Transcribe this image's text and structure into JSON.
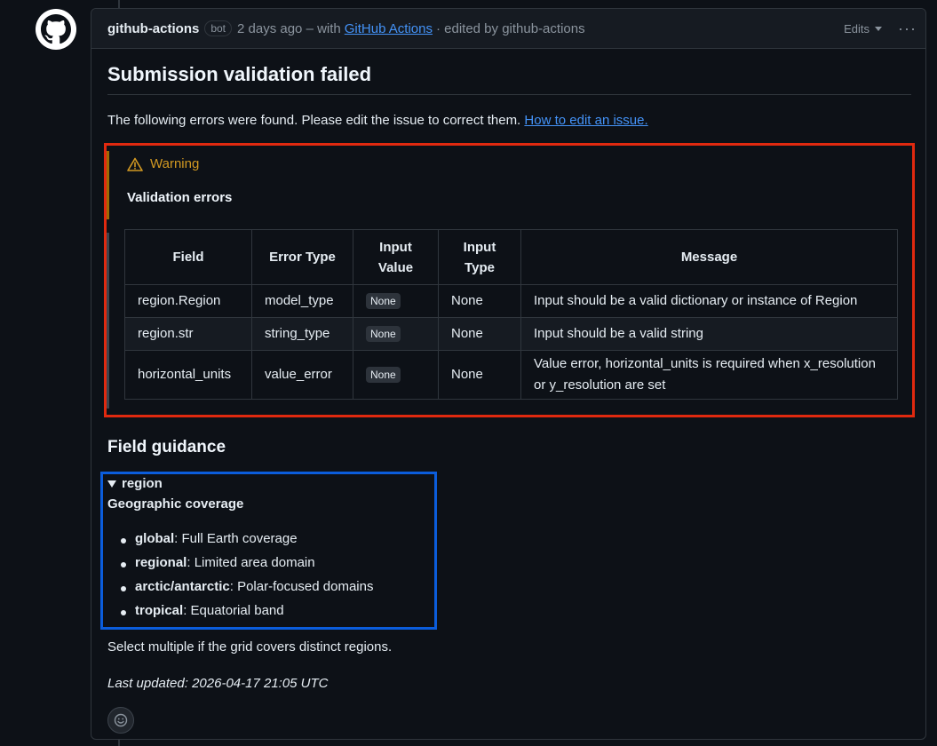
{
  "comment": {
    "author": "github-actions",
    "badge": "bot",
    "time": "2 days ago – with",
    "app_link": "GitHub Actions",
    "edited_by": "· edited by github-actions",
    "edits_label": "Edits",
    "more_label": "···"
  },
  "content": {
    "title": "Submission validation failed",
    "intro": "The following errors were found. Please edit the issue to correct them.",
    "intro_link": "How to edit an issue.",
    "alert_label": "Warning",
    "alert_sub": "Validation errors",
    "table": {
      "headers": [
        "Field",
        "Error Type",
        "Input Value",
        "Input Type",
        "Message"
      ],
      "rows": [
        {
          "field": "region.Region",
          "error_type": "model_type",
          "input_value": "None",
          "input_type": "None",
          "message": "Input should be a valid dictionary or instance of Region"
        },
        {
          "field": "region.str",
          "error_type": "string_type",
          "input_value": "None",
          "input_type": "None",
          "message": "Input should be a valid string"
        },
        {
          "field": "horizontal_units",
          "error_type": "value_error",
          "input_value": "None",
          "input_type": "None",
          "message": "Value error, horizontal_units is required when x_resolution or y_resolution are set"
        }
      ]
    },
    "guidance_title": "Field guidance",
    "details_summary": "region",
    "details_heading": "Geographic coverage",
    "options": [
      {
        "term": "global",
        "desc": ": Full Earth coverage"
      },
      {
        "term": "regional",
        "desc": ": Limited area domain"
      },
      {
        "term": "arctic/antarctic",
        "desc": ": Polar-focused domains"
      },
      {
        "term": "tropical",
        "desc": ": Equatorial band"
      }
    ],
    "select_note": "Select multiple if the grid covers distinct regions.",
    "last_updated": "Last updated: 2026-04-17 21:05 UTC"
  },
  "colors": {
    "annotation_red": "#e0290f",
    "annotation_blue": "#0b5ddc",
    "warning": "#d29922",
    "link": "#4493f8"
  }
}
